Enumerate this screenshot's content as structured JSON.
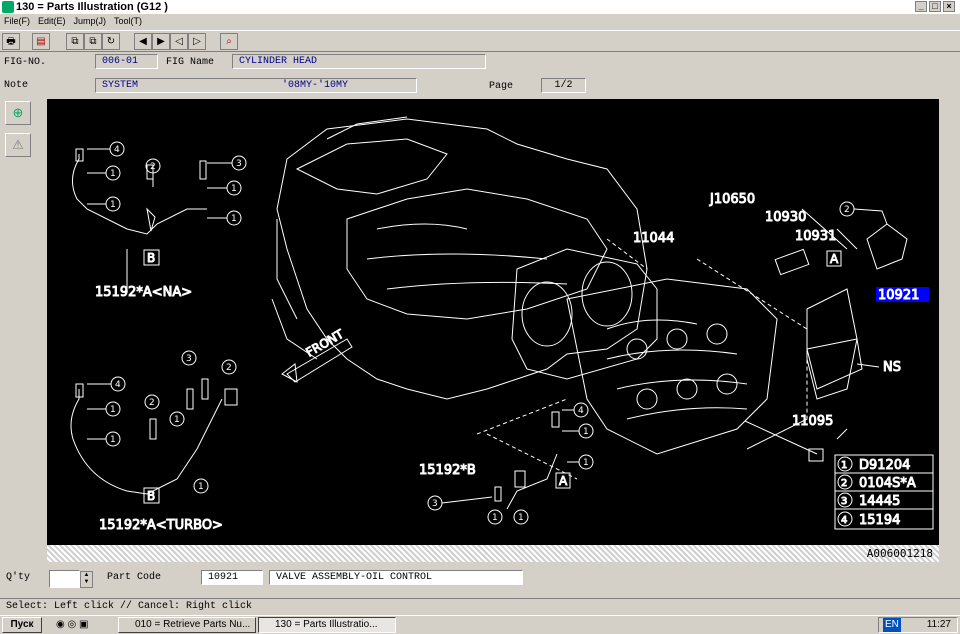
{
  "window": {
    "title": "130 = Parts Illustration (G12  )",
    "controls": [
      "_",
      "□",
      "×"
    ]
  },
  "menu": [
    "File(F)",
    "Edit(E)",
    "Jump(J)",
    "Tool(T)"
  ],
  "header": {
    "fig_no_label": "FIG-NO.",
    "fig_no": "006-01",
    "fig_name_label": "FIG Name",
    "fig_name": "CYLINDER HEAD",
    "note_label": "Note",
    "note": "SYSTEM",
    "note_years": "'08MY-'10MY",
    "page_label": "Page",
    "page": "1/2"
  },
  "illustration": {
    "labels": {
      "hose_na": "15192*A<NA>",
      "hose_turbo": "15192*A<TURBO>",
      "hose_b": "15192*B",
      "head": "11044",
      "j10650": "J10650",
      "p10930": "10930",
      "p10931": "10931",
      "p10921": "10921",
      "ns": "NS",
      "p11095": "11095",
      "front": "FRONT",
      "letter_a": "A",
      "letter_b": "B"
    },
    "legend": [
      {
        "num": "1",
        "part": "D91204"
      },
      {
        "num": "2",
        "part": "0104S*A"
      },
      {
        "num": "3",
        "part": "14445"
      },
      {
        "num": "4",
        "part": "15194"
      }
    ],
    "drawing_id": "A006001218",
    "highlight_color": "#0000ff"
  },
  "footer": {
    "qty_label": "Q'ty",
    "qty": "",
    "part_code_label": "Part Code",
    "part_code": "10921",
    "part_name": "VALVE ASSEMBLY-OIL CONTROL"
  },
  "status": "Select: Left click // Cancel: Right click",
  "taskbar": {
    "start": "Пуск",
    "tasks": [
      "010 = Retrieve Parts Nu...",
      "130 = Parts Illustratio..."
    ],
    "lang": "EN",
    "time": "11:27"
  }
}
